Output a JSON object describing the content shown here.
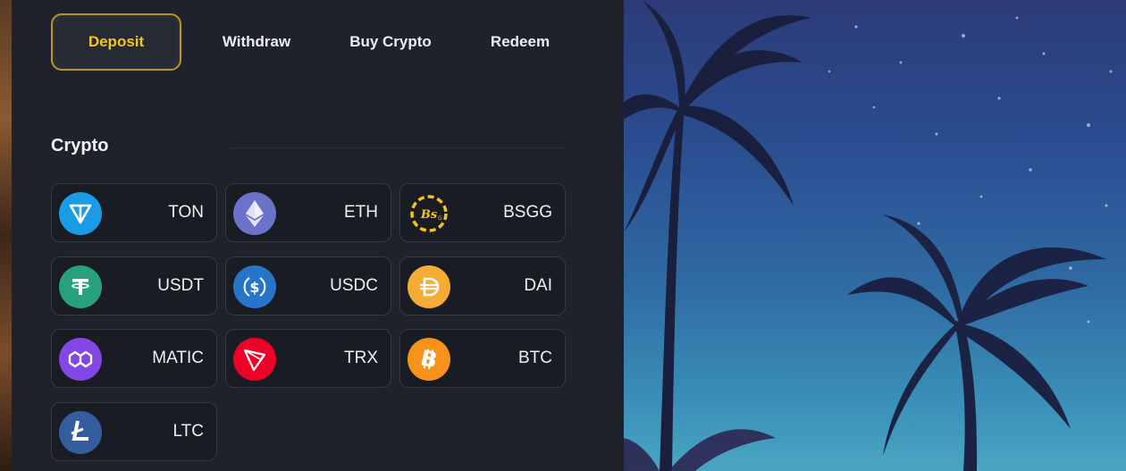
{
  "tabs": [
    {
      "label": "Deposit",
      "active": true
    },
    {
      "label": "Withdraw"
    },
    {
      "label": "Buy Crypto"
    },
    {
      "label": "Redeem"
    }
  ],
  "section_title": "Crypto",
  "coins": [
    {
      "ticker": "TON",
      "icon": "ton-icon",
      "color": "#1a9be6"
    },
    {
      "ticker": "ETH",
      "icon": "eth-icon",
      "color": "#6a73c9"
    },
    {
      "ticker": "BSGG",
      "icon": "bsgg-icon",
      "color": "#f2c318"
    },
    {
      "ticker": "USDT",
      "icon": "usdt-icon",
      "color": "#26a17b"
    },
    {
      "ticker": "USDC",
      "icon": "usdc-icon",
      "color": "#2775ca"
    },
    {
      "ticker": "DAI",
      "icon": "dai-icon",
      "color": "#f5ac37"
    },
    {
      "ticker": "MATIC",
      "icon": "matic-icon",
      "color": "#8247e5"
    },
    {
      "ticker": "TRX",
      "icon": "trx-icon",
      "color": "#ef0027"
    },
    {
      "ticker": "BTC",
      "icon": "btc-icon",
      "color": "#f7931a"
    },
    {
      "ticker": "LTC",
      "icon": "ltc-icon",
      "color": "#345d9d"
    }
  ]
}
